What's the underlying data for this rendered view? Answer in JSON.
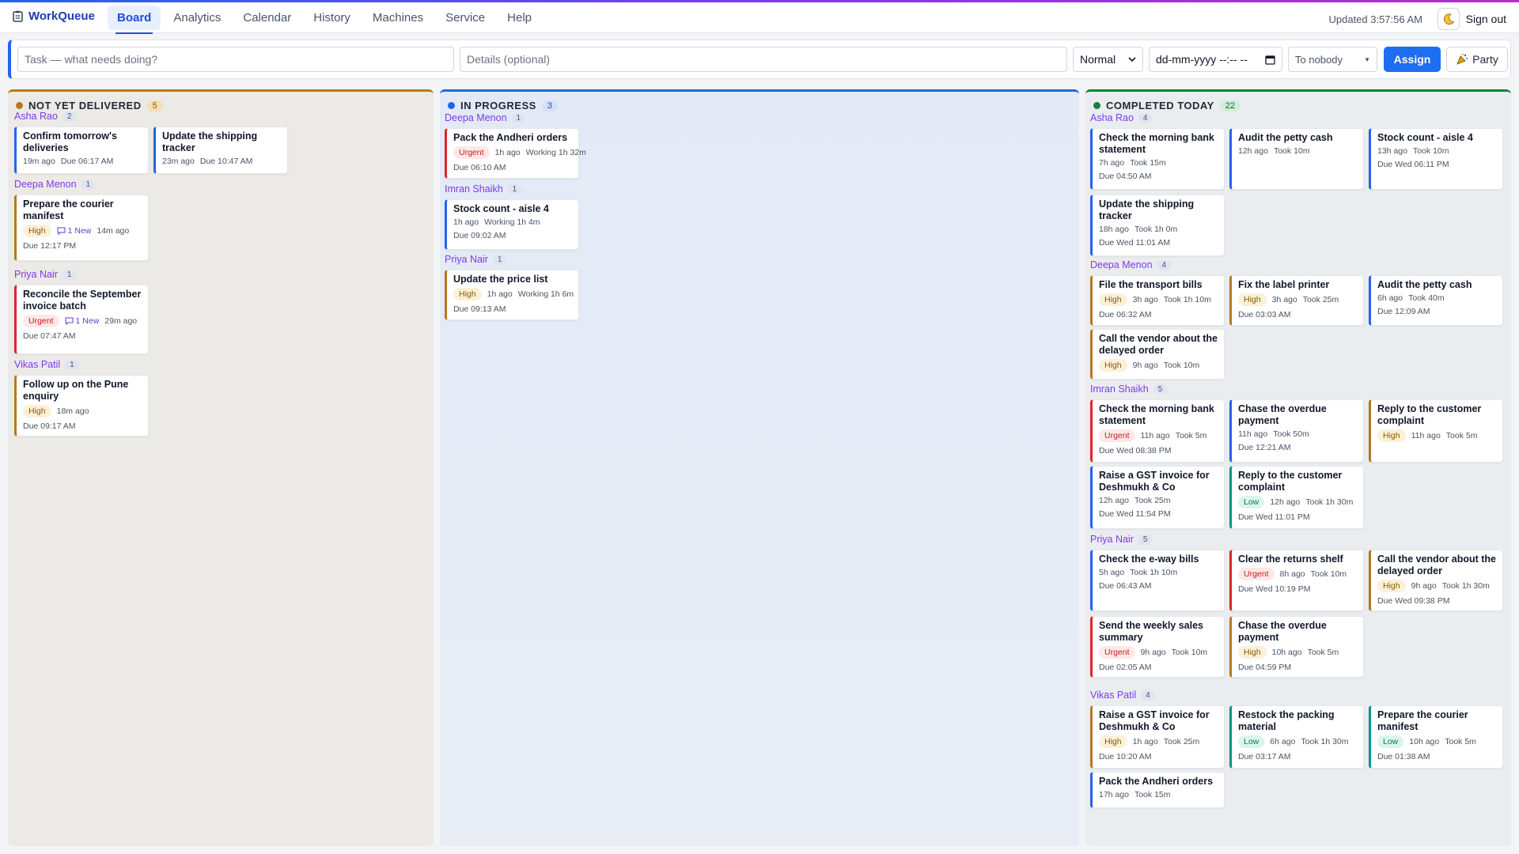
{
  "app": {
    "name": "WorkQueue",
    "logo_icon": "clipboard-icon"
  },
  "nav": [
    {
      "label": "Board",
      "active": true
    },
    {
      "label": "Analytics"
    },
    {
      "label": "Calendar"
    },
    {
      "label": "History"
    },
    {
      "label": "Machines"
    },
    {
      "label": "Service"
    },
    {
      "label": "Help"
    }
  ],
  "header": {
    "updated": "Updated 3:57:56 AM",
    "theme_icon": "moon-icon",
    "signout": "Sign out"
  },
  "composer": {
    "task_placeholder": "Task — what needs doing?",
    "details_placeholder": "Details (optional)",
    "priority": "Normal",
    "date_placeholder": "dd-mm-yyyy --:-- --",
    "assignee": "To nobody",
    "assign": "Assign",
    "party": "Party",
    "party_icon": "party-popper-icon"
  },
  "colors": {
    "high": "#b7791f",
    "urgent": "#dc2626",
    "normal": "#2563eb",
    "low": "#0d9488",
    "not_delivered": "#b7791f",
    "in_progress": "#2563eb",
    "completed": "#15803d"
  },
  "columns": [
    {
      "title": "NOT YET DELIVERED",
      "count": "5",
      "groups": [
        {
          "name": "Asha Rao",
          "count": "2",
          "cards": [
            {
              "title": "Confirm tomorrow's deliveries",
              "priority": "normal",
              "meta": [
                "19m ago",
                "Due 06:17 AM"
              ]
            },
            {
              "title": "Update the shipping tracker",
              "priority": "normal",
              "meta": [
                "23m ago",
                "Due 10:47 AM"
              ]
            }
          ]
        },
        {
          "name": "Deepa Menon",
          "count": "1",
          "cards": [
            {
              "title": "Prepare the courier manifest",
              "priority": "high",
              "badge": "High",
              "comments": "1 New",
              "meta": [
                "14m ago"
              ],
              "due": "Due 12:17 PM"
            }
          ]
        },
        {
          "name": "Priya Nair",
          "count": "1",
          "cards": [
            {
              "title": "Reconcile the September invoice batch",
              "priority": "urgent",
              "badge": "Urgent",
              "comments": "1 New",
              "meta": [
                "29m ago"
              ],
              "due": "Due 07:47 AM"
            }
          ]
        },
        {
          "name": "Vikas Patil",
          "count": "1",
          "cards": [
            {
              "title": "Follow up on the Pune enquiry",
              "priority": "high",
              "badge": "High",
              "meta": [
                "18m ago"
              ],
              "due": "Due 09:17 AM"
            }
          ]
        }
      ]
    },
    {
      "title": "IN PROGRESS",
      "count": "3",
      "groups": [
        {
          "name": "Deepa Menon",
          "count": "1",
          "cards": [
            {
              "title": "Pack the Andheri orders",
              "priority": "urgent",
              "badge": "Urgent",
              "meta": [
                "1h ago",
                "Working 1h 32m"
              ],
              "due": "Due 06:10 AM"
            }
          ]
        },
        {
          "name": "Imran Shaikh",
          "count": "1",
          "cards": [
            {
              "title": "Stock count - aisle 4",
              "priority": "normal",
              "meta": [
                "1h ago",
                "Working 1h 4m"
              ],
              "due": "Due 09:02 AM"
            }
          ]
        },
        {
          "name": "Priya Nair",
          "count": "1",
          "cards": [
            {
              "title": "Update the price list",
              "priority": "high",
              "badge": "High",
              "meta": [
                "1h ago",
                "Working 1h 6m"
              ],
              "due": "Due 09:13 AM"
            }
          ]
        }
      ]
    },
    {
      "title": "COMPLETED TODAY",
      "count": "22",
      "groups": [
        {
          "name": "Asha Rao",
          "count": "4",
          "cards": [
            {
              "title": "Check the morning bank statement",
              "priority": "normal",
              "meta": [
                "7h ago",
                "Took 15m"
              ],
              "due": "Due 04:50 AM"
            },
            {
              "title": "Audit the petty cash",
              "priority": "normal",
              "meta": [
                "12h ago",
                "Took 10m"
              ]
            },
            {
              "title": "Stock count - aisle 4",
              "priority": "normal",
              "meta": [
                "13h ago",
                "Took 10m"
              ],
              "due": "Due Wed 06:11 PM"
            },
            {
              "title": "Update the shipping tracker",
              "priority": "normal",
              "meta": [
                "18h ago",
                "Took 1h 0m"
              ],
              "due": "Due Wed 11:01 AM"
            }
          ]
        },
        {
          "name": "Deepa Menon",
          "count": "4",
          "cards": [
            {
              "title": "File the transport bills",
              "priority": "high",
              "badge": "High",
              "meta": [
                "3h ago",
                "Took 1h 10m"
              ],
              "due": "Due 06:32 AM"
            },
            {
              "title": "Fix the label printer",
              "priority": "high",
              "badge": "High",
              "meta": [
                "3h ago",
                "Took 25m"
              ],
              "due": "Due 03:03 AM"
            },
            {
              "title": "Audit the petty cash",
              "priority": "normal",
              "meta": [
                "6h ago",
                "Took 40m"
              ],
              "due": "Due 12:09 AM"
            },
            {
              "title": "Call the vendor about the delayed order",
              "priority": "high",
              "badge": "High",
              "meta": [
                "9h ago",
                "Took 10m"
              ]
            }
          ]
        },
        {
          "name": "Imran Shaikh",
          "count": "5",
          "cards": [
            {
              "title": "Check the morning bank statement",
              "priority": "urgent",
              "badge": "Urgent",
              "meta": [
                "11h ago",
                "Took 5m"
              ],
              "due": "Due Wed 08:38 PM"
            },
            {
              "title": "Chase the overdue payment",
              "priority": "normal",
              "meta": [
                "11h ago",
                "Took 50m"
              ],
              "due": "Due 12:21 AM"
            },
            {
              "title": "Reply to the customer complaint",
              "priority": "high",
              "badge": "High",
              "meta": [
                "11h ago",
                "Took 5m"
              ]
            },
            {
              "title": "Raise a GST invoice for Deshmukh & Co",
              "priority": "normal",
              "meta": [
                "12h ago",
                "Took 25m"
              ],
              "due": "Due Wed 11:54 PM"
            },
            {
              "title": "Reply to the customer complaint",
              "priority": "low",
              "badge": "Low",
              "meta": [
                "12h ago",
                "Took 1h 30m"
              ],
              "due": "Due Wed 11:01 PM"
            }
          ]
        },
        {
          "name": "Priya Nair",
          "count": "5",
          "cards": [
            {
              "title": "Check the e-way bills",
              "priority": "normal",
              "meta": [
                "5h ago",
                "Took 1h 10m"
              ],
              "due": "Due 06:43 AM"
            },
            {
              "title": "Clear the returns shelf",
              "priority": "urgent",
              "badge": "Urgent",
              "meta": [
                "8h ago",
                "Took 10m"
              ],
              "due": "Due Wed 10:19 PM"
            },
            {
              "title": "Call the vendor about the delayed order",
              "priority": "high",
              "badge": "High",
              "meta": [
                "9h ago",
                "Took 1h 30m"
              ],
              "due": "Due Wed 09:38 PM"
            },
            {
              "title": "Send the weekly sales summary",
              "priority": "urgent",
              "badge": "Urgent",
              "meta": [
                "9h ago",
                "Took 10m"
              ],
              "due": "Due 02:05 AM"
            },
            {
              "title": "Chase the overdue payment",
              "priority": "high",
              "badge": "High",
              "meta": [
                "10h ago",
                "Took 5m"
              ],
              "due": "Due 04:59 PM"
            }
          ]
        },
        {
          "name": "Vikas Patil",
          "count": "4",
          "cards": [
            {
              "title": "Raise a GST invoice for Deshmukh & Co",
              "priority": "high",
              "badge": "High",
              "meta": [
                "1h ago",
                "Took 25m"
              ],
              "due": "Due 10:20 AM"
            },
            {
              "title": "Restock the packing material",
              "priority": "low",
              "badge": "Low",
              "meta": [
                "6h ago",
                "Took 1h 30m"
              ],
              "due": "Due 03:17 AM"
            },
            {
              "title": "Prepare the courier manifest",
              "priority": "low",
              "badge": "Low",
              "meta": [
                "10h ago",
                "Took 5m"
              ],
              "due": "Due 01:38 AM"
            },
            {
              "title": "Pack the Andheri orders",
              "priority": "normal",
              "meta": [
                "17h ago",
                "Took 15m"
              ]
            }
          ]
        }
      ]
    }
  ]
}
